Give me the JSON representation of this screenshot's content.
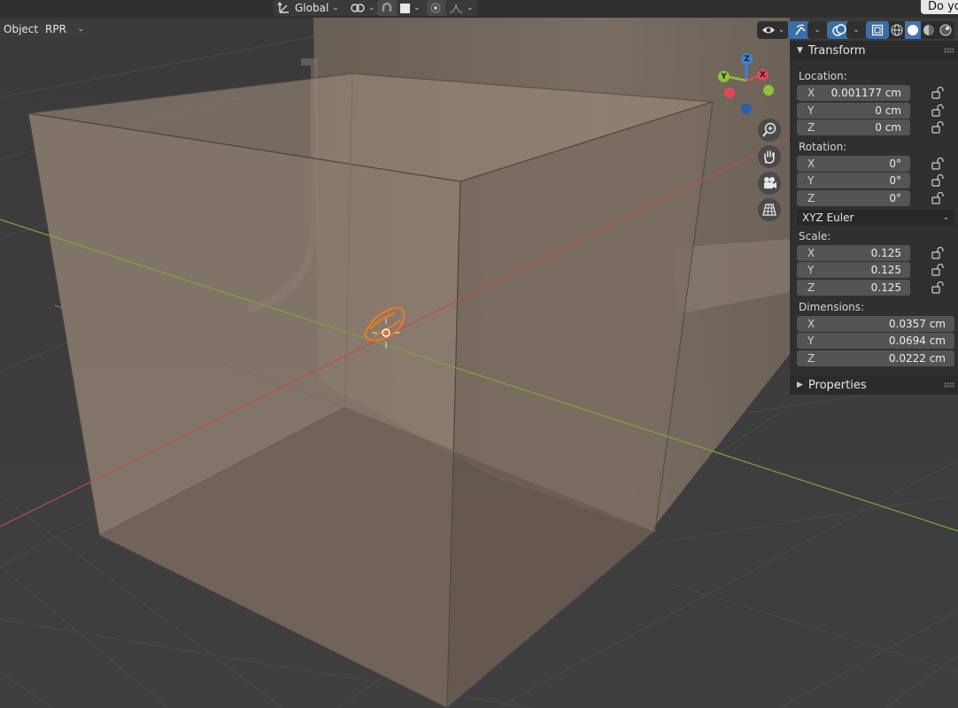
{
  "header": {
    "orientation_label": "Global",
    "mode_label": "Object",
    "engine_label": "RPR"
  },
  "tooltip": {
    "text": "Do you"
  },
  "gizmo": {
    "z": "Z",
    "y": "Y",
    "x": "X"
  },
  "panel": {
    "transform_title": "Transform",
    "location_label": "Location:",
    "location": [
      {
        "axis": "X",
        "value": "0.001177 cm"
      },
      {
        "axis": "Y",
        "value": "0 cm"
      },
      {
        "axis": "Z",
        "value": "0 cm"
      }
    ],
    "rotation_label": "Rotation:",
    "rotation": [
      {
        "axis": "X",
        "value": "0°"
      },
      {
        "axis": "Y",
        "value": "0°"
      },
      {
        "axis": "Z",
        "value": "0°"
      }
    ],
    "rotation_mode": "XYZ Euler",
    "scale_label": "Scale:",
    "scale": [
      {
        "axis": "X",
        "value": "0.125"
      },
      {
        "axis": "Y",
        "value": "0.125"
      },
      {
        "axis": "Z",
        "value": "0.125"
      }
    ],
    "dimensions_label": "Dimensions:",
    "dimensions": [
      {
        "axis": "X",
        "value": "0.0357 cm"
      },
      {
        "axis": "Y",
        "value": "0.0694 cm"
      },
      {
        "axis": "Z",
        "value": "0.0222 cm"
      }
    ],
    "properties_title": "Properties"
  },
  "colors": {
    "axis_x": "#e0475a",
    "axis_y": "#8fc23a",
    "axis_z": "#3a84e0",
    "selection": "#f07a1a",
    "accent": "#4772b3"
  }
}
